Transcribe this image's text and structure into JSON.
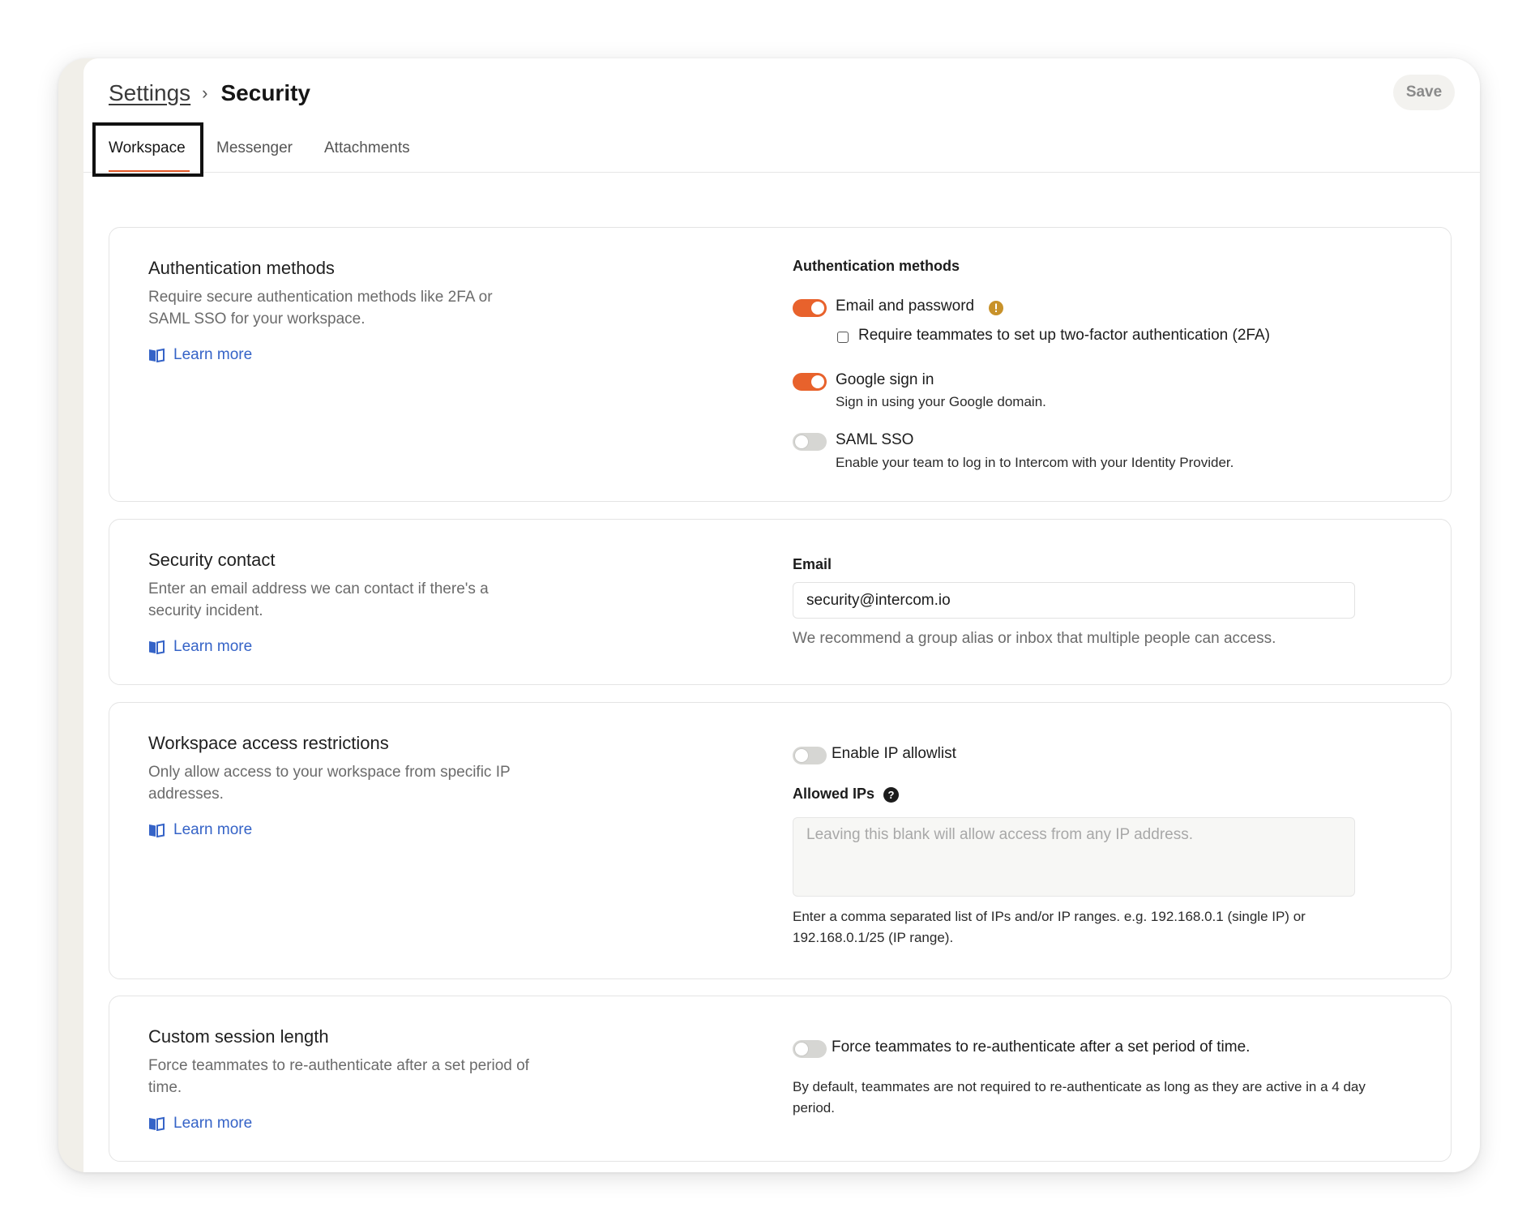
{
  "header": {
    "breadcrumb_parent": "Settings",
    "breadcrumb_current": "Security",
    "save_label": "Save"
  },
  "tabs": [
    {
      "label": "Workspace",
      "active": true
    },
    {
      "label": "Messenger",
      "active": false
    },
    {
      "label": "Attachments",
      "active": false
    }
  ],
  "learn_more_label": "Learn more",
  "sections": {
    "auth": {
      "title": "Authentication methods",
      "description": "Require secure authentication methods like 2FA or SAML SSO for your workspace.",
      "right_heading": "Authentication methods",
      "email_password": {
        "label": "Email and password",
        "enabled": true
      },
      "require_2fa": {
        "label": "Require teammates to set up two-factor authentication (2FA)",
        "checked": false
      },
      "google": {
        "label": "Google sign in",
        "sub": "Sign in using your Google domain.",
        "enabled": true
      },
      "saml": {
        "label": "SAML SSO",
        "sub": "Enable your team to log in to Intercom with your Identity Provider.",
        "enabled": false
      }
    },
    "contact": {
      "title": "Security contact",
      "description": "Enter an email address we can contact if there's a security incident.",
      "email_label": "Email",
      "email_value": "security@intercom.io",
      "hint": "We recommend a group alias or inbox that multiple people can access."
    },
    "access": {
      "title": "Workspace access restrictions",
      "description": "Only allow access to your workspace from specific IP addresses.",
      "toggle_label": "Enable IP allowlist",
      "toggle_enabled": false,
      "allowed_ips_label": "Allowed IPs",
      "allowed_ips_placeholder": "Leaving this blank will allow access from any IP address.",
      "hint": "Enter a comma separated list of IPs and/or IP ranges. e.g. 192.168.0.1 (single IP) or 192.168.0.1/25 (IP range)."
    },
    "session": {
      "title": "Custom session length",
      "description": "Force teammates to re-authenticate after a set period of time.",
      "toggle_label": "Force teammates to re-authenticate after a set period of time.",
      "toggle_enabled": false,
      "hint": "By default, teammates are not required to re-authenticate as long as they are active in a 4 day period."
    }
  },
  "colors": {
    "accent": "#e8622c",
    "link": "#3563c7",
    "warning": "#c8922a"
  },
  "icons": [
    "chevron-right-icon",
    "book-icon",
    "warning-icon",
    "help-icon"
  ]
}
